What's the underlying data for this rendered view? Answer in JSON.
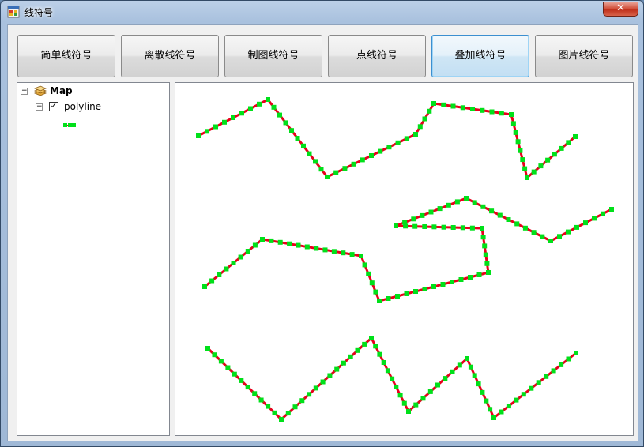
{
  "window": {
    "title": "线符号",
    "close_label": "✕"
  },
  "toolbar": {
    "buttons": [
      {
        "label": "简单线符号",
        "focused": false
      },
      {
        "label": "离散线符号",
        "focused": false
      },
      {
        "label": "制图线符号",
        "focused": false
      },
      {
        "label": "点线符号",
        "focused": false
      },
      {
        "label": "叠加线符号",
        "focused": true
      },
      {
        "label": "图片线符号",
        "focused": false
      }
    ]
  },
  "toc": {
    "map_label": "Map",
    "layer_label": "polyline",
    "layer_checked": true
  },
  "colors": {
    "line": "#e8001c",
    "marker": "#00e01a"
  },
  "icons": {
    "app": "app-window-icon",
    "layers": "layers-icon",
    "legend": "line-symbol-legend-icon"
  }
}
